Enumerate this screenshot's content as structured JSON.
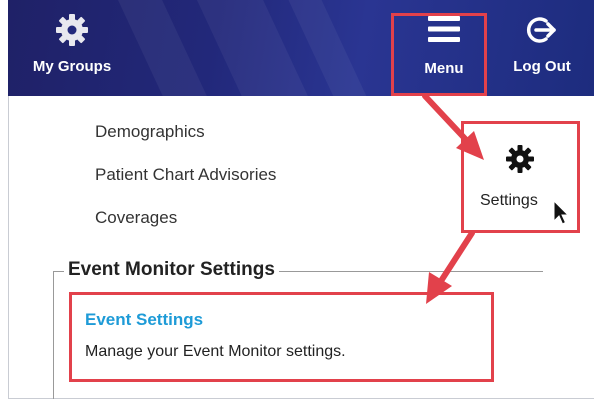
{
  "header": {
    "my_groups_label": "My Groups",
    "menu_label": "Menu",
    "logout_label": "Log Out"
  },
  "menu_items": [
    "Demographics",
    "Patient Chart Advisories",
    "Coverages"
  ],
  "settings_popup": {
    "label": "Settings",
    "icon": "gear-icon"
  },
  "event_monitor": {
    "section_title": "Event Monitor Settings",
    "link_title": "Event Settings",
    "description": "Manage your Event Monitor settings."
  },
  "colors": {
    "header_bg": "#1f2167",
    "highlight": "#e2414b",
    "link": "#1e9bd7"
  }
}
